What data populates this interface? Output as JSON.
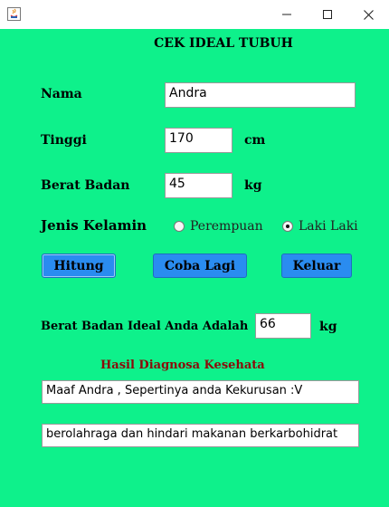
{
  "window": {
    "title": ""
  },
  "heading": "CEK IDEAL TUBUH",
  "form": {
    "nama_label": "Nama",
    "nama_value": "Andra",
    "tinggi_label": "Tinggi",
    "tinggi_value": "170",
    "tinggi_unit": "cm",
    "berat_label": "Berat Badan",
    "berat_value": "45",
    "berat_unit": "kg",
    "jenis_label": "Jenis Kelamin",
    "radio_perempuan": "Perempuan",
    "radio_laki": "Laki Laki",
    "selected_gender": "Laki Laki"
  },
  "buttons": {
    "hitung": "Hitung",
    "coba_lagi": "Coba Lagi",
    "keluar": "Keluar"
  },
  "result": {
    "ideal_label": "Berat Badan Ideal Anda Adalah",
    "ideal_value": "66",
    "ideal_unit": "kg",
    "diagnosa_title": "Hasil Diagnosa Kesehata",
    "diagnosa_line1": "Maaf Andra , Sepertinya anda Kekurusan :V",
    "diagnosa_line2": "berolahraga dan hindari makanan berkarbohidrat"
  },
  "colors": {
    "background": "#0ef18b",
    "button": "#2a8cf0",
    "diagnosa_title": "#8b0a0a"
  }
}
